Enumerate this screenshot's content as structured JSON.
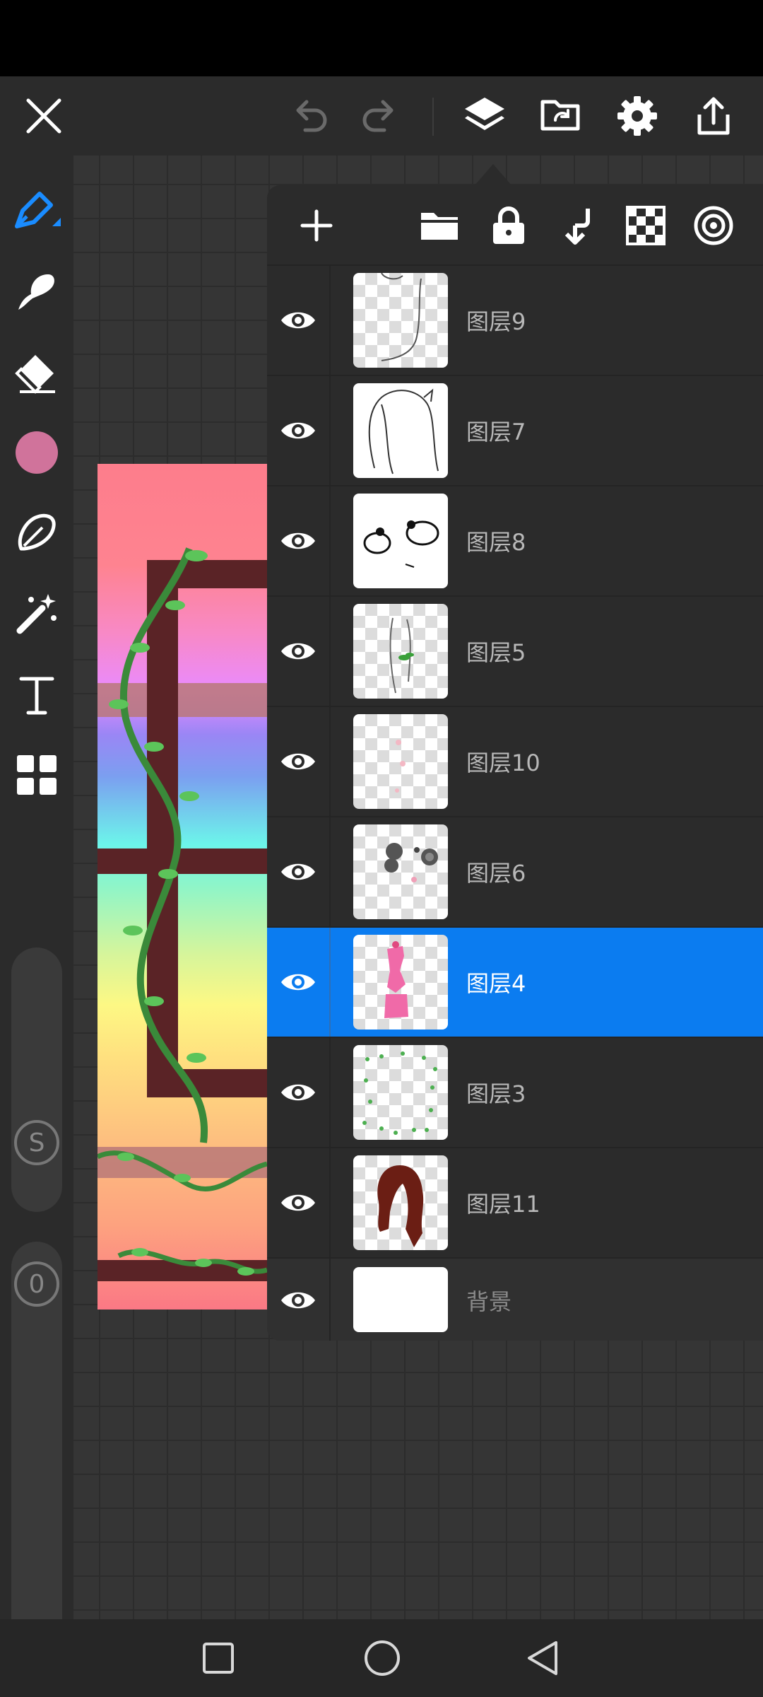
{
  "colors": {
    "accent": "#0b7cf0",
    "current_color": "#d0739b",
    "panel_bg": "#2b2b2b",
    "toolbar_bg": "#2b2b2b"
  },
  "top_bar": {
    "icons": [
      "close-icon",
      "undo-icon",
      "redo-icon",
      "layers-icon",
      "import-icon",
      "settings-icon",
      "share-icon"
    ]
  },
  "left_toolbar": {
    "tools": [
      "pen-icon",
      "smudge-icon",
      "eraser-icon",
      "color-swatch",
      "lasso-icon",
      "magic-wand-icon",
      "text-icon",
      "grid-icon"
    ],
    "size_slider_badge": "S",
    "opacity_slider_badge": "0"
  },
  "layer_panel": {
    "header_icons": [
      "add-icon",
      "folder-icon",
      "lock-icon",
      "merge-down-icon",
      "checkerboard-icon",
      "target-icon"
    ],
    "layers": [
      {
        "name": "图层9",
        "visible": true,
        "selected": false
      },
      {
        "name": "图层7",
        "visible": true,
        "selected": false
      },
      {
        "name": "图层8",
        "visible": true,
        "selected": false
      },
      {
        "name": "图层5",
        "visible": true,
        "selected": false
      },
      {
        "name": "图层10",
        "visible": true,
        "selected": false
      },
      {
        "name": "图层6",
        "visible": true,
        "selected": false
      },
      {
        "name": "图层4",
        "visible": true,
        "selected": true
      },
      {
        "name": "图层3",
        "visible": true,
        "selected": false
      },
      {
        "name": "图层11",
        "visible": true,
        "selected": false
      }
    ],
    "background_layer": {
      "name": "背景",
      "visible": true
    }
  },
  "nav_bar": {
    "icons": [
      "recents-square-icon",
      "home-circle-icon",
      "back-triangle-icon"
    ]
  }
}
